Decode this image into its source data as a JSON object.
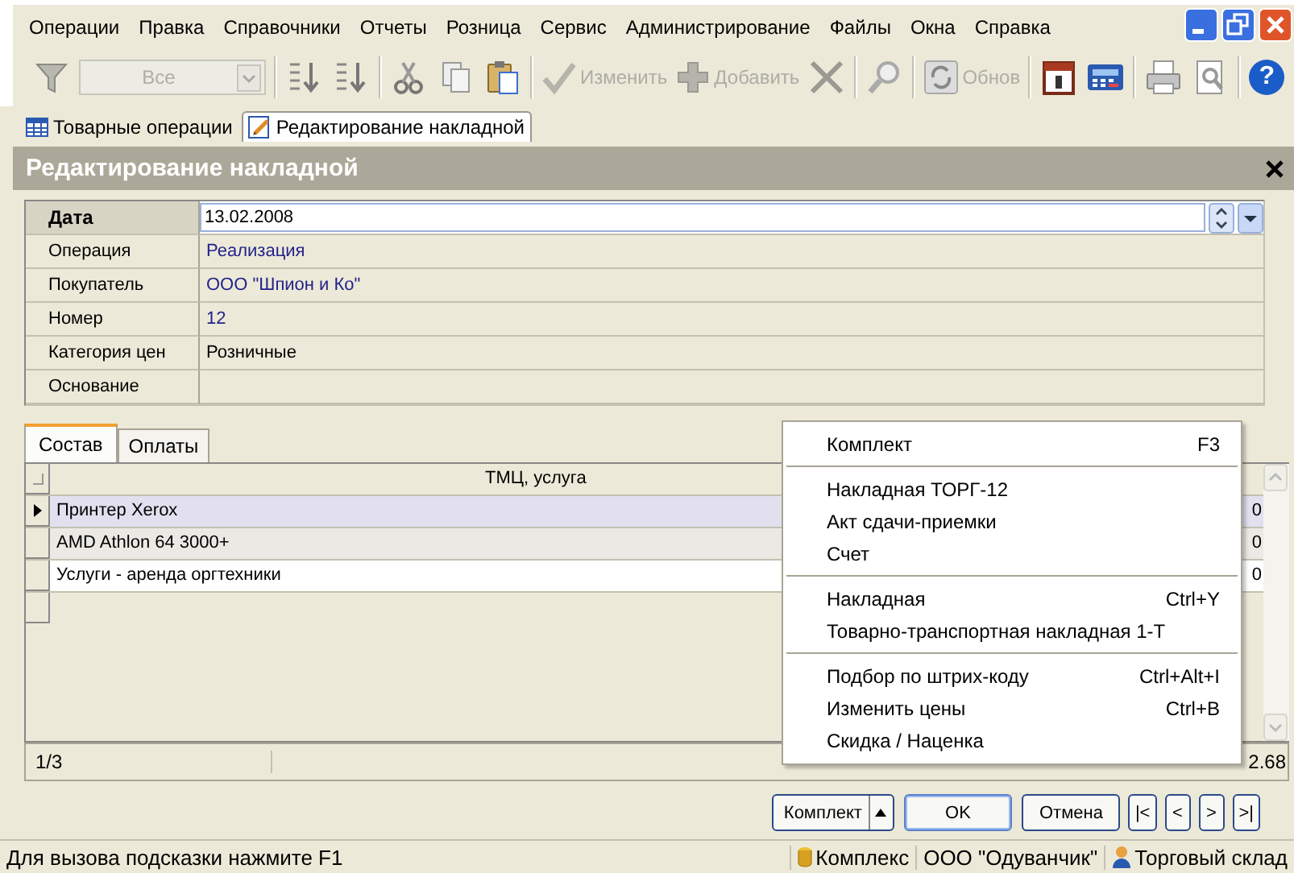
{
  "menu": [
    "Операции",
    "Правка",
    "Справочники",
    "Отчеты",
    "Розница",
    "Сервис",
    "Администрирование",
    "Файлы",
    "Окна",
    "Справка"
  ],
  "toolbar": {
    "filter_value": "Все",
    "edit_label": "Изменить",
    "add_label": "Добавить",
    "refresh_label": "Обнов",
    "help": "?"
  },
  "doc_tabs": [
    {
      "label": "Товарные операции",
      "selected": false
    },
    {
      "label": "Редактирование накладной",
      "selected": true
    }
  ],
  "form": {
    "title": "Редактирование накладной",
    "fields": [
      {
        "label": "Дата",
        "value": "13.02.2008",
        "kind": "date",
        "selected": true
      },
      {
        "label": "Операция",
        "value": "Реализация",
        "kind": "reference",
        "selected": false
      },
      {
        "label": "Покупатель",
        "value": "ООО \"Шпион и Ко\"",
        "kind": "reference",
        "selected": false
      },
      {
        "label": "Номер",
        "value": "12",
        "kind": "reference",
        "selected": false
      },
      {
        "label": "Категория цен",
        "value": "Розничные",
        "kind": "text",
        "selected": false
      },
      {
        "label": "Основание",
        "kind": "text",
        "selected": false
      }
    ]
  },
  "tabs": [
    {
      "label": "Состав",
      "selected": true
    },
    {
      "label": "Оплаты",
      "selected": false
    }
  ],
  "table": {
    "columns": [
      "ТМЦ, услуга"
    ],
    "rows": [
      {
        "item": "Принтер Xerox",
        "column_2": "0",
        "selected": true
      },
      {
        "item": "AMD Athlon 64 3000+",
        "column_2": "0",
        "selected": false
      },
      {
        "item": "Услуги - аренда оргтехники",
        "column_2": "0",
        "selected": false
      }
    ],
    "footer": {
      "count": "1/3",
      "total": "2.68"
    }
  },
  "context_menu": {
    "items": [
      {
        "kind": "item",
        "label": "Комплект",
        "shortcut": "F3"
      },
      {
        "kind": "separator"
      },
      {
        "kind": "item",
        "label": "Накладная ТОРГ-12"
      },
      {
        "kind": "item",
        "label": "Акт сдачи-приемки"
      },
      {
        "kind": "item",
        "label": "Счет"
      },
      {
        "kind": "separator"
      },
      {
        "kind": "item",
        "label": "Накладная",
        "shortcut": "Ctrl+Y"
      },
      {
        "kind": "item",
        "label": "Товарно-транспортная накладная 1-Т"
      },
      {
        "kind": "separator"
      },
      {
        "kind": "item",
        "label": "Подбор по штрих-коду",
        "shortcut": "Ctrl+Alt+I"
      },
      {
        "kind": "item",
        "label": "Изменить цены",
        "shortcut": "Ctrl+B"
      },
      {
        "kind": "item",
        "label": "Скидка / Наценка"
      }
    ]
  },
  "buttons": {
    "kit": "Комплект",
    "ok": "OK",
    "cancel": "Отмена",
    "nav": [
      "|<",
      "<",
      ">",
      ">|"
    ]
  },
  "status_bar": {
    "hint": "Для вызова подсказки нажмите F1",
    "database": "Комплекс",
    "company": "ООО \"Одуванчик\"",
    "warehouse": "Торговый склад"
  }
}
